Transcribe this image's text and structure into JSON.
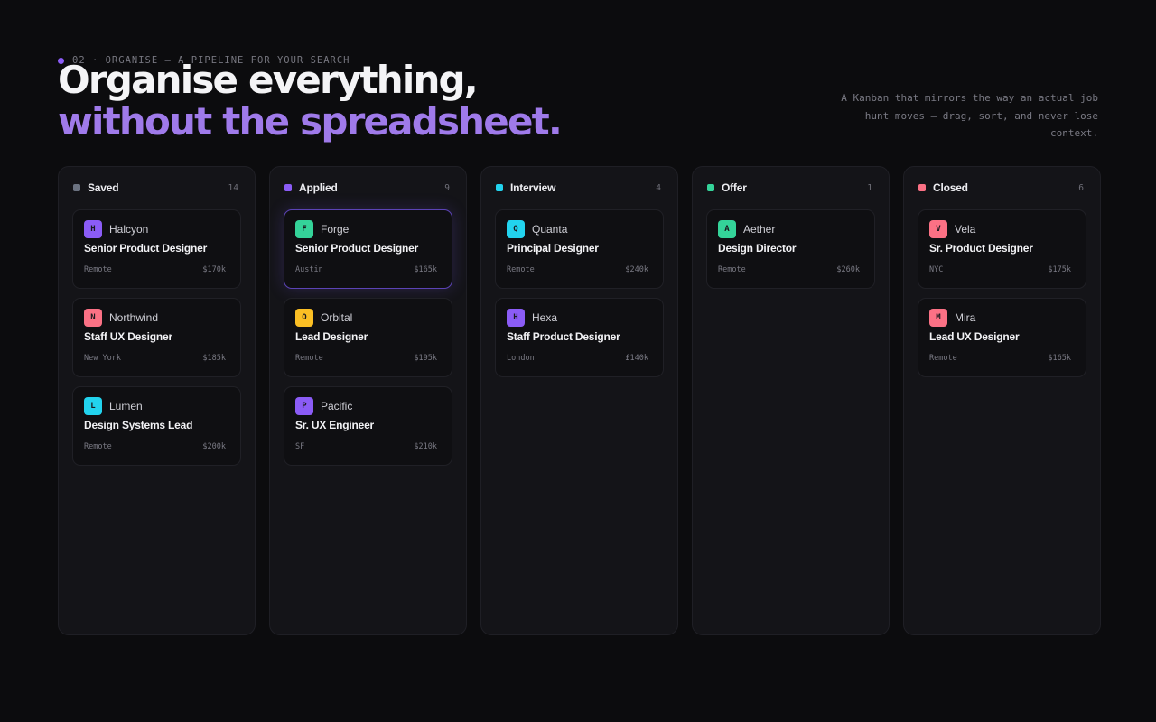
{
  "header": {
    "eyebrow": "02 · ORGANISE — A PIPELINE FOR YOUR SEARCH",
    "title_line1": "Organise everything,",
    "title_line2": "without the spreadsheet.",
    "blurb": "A Kanban that mirrors the way an actual job hunt moves — drag, sort, and never lose context."
  },
  "colors": {
    "accent": "#8b5cf6",
    "saved": "#6b7280",
    "applied": "#8b5cf6",
    "interview": "#22d3ee",
    "offer": "#34d399",
    "closed": "#fb7185"
  },
  "columns": [
    {
      "title": "Saved",
      "count": "14",
      "color": "#6b7280",
      "cards": [
        {
          "initial": "H",
          "company": "Halcyon",
          "role": "Senior Product Designer",
          "location": "Remote",
          "salary": "$170k",
          "logo_color": "#8b5cf6"
        },
        {
          "initial": "N",
          "company": "Northwind",
          "role": "Staff UX Designer",
          "location": "New York",
          "salary": "$185k",
          "logo_color": "#fb7185"
        },
        {
          "initial": "L",
          "company": "Lumen",
          "role": "Design Systems Lead",
          "location": "Remote",
          "salary": "$200k",
          "logo_color": "#22d3ee"
        }
      ]
    },
    {
      "title": "Applied",
      "count": "9",
      "color": "#8b5cf6",
      "cards": [
        {
          "initial": "F",
          "company": "Forge",
          "role": "Senior Product Designer",
          "location": "Austin",
          "salary": "$165k",
          "logo_color": "#34d399",
          "active": true
        },
        {
          "initial": "O",
          "company": "Orbital",
          "role": "Lead Designer",
          "location": "Remote",
          "salary": "$195k",
          "logo_color": "#fbbf24"
        },
        {
          "initial": "P",
          "company": "Pacific",
          "role": "Sr. UX Engineer",
          "location": "SF",
          "salary": "$210k",
          "logo_color": "#8b5cf6"
        }
      ]
    },
    {
      "title": "Interview",
      "count": "4",
      "color": "#22d3ee",
      "cards": [
        {
          "initial": "Q",
          "company": "Quanta",
          "role": "Principal Designer",
          "location": "Remote",
          "salary": "$240k",
          "logo_color": "#22d3ee"
        },
        {
          "initial": "H",
          "company": "Hexa",
          "role": "Staff Product Designer",
          "location": "London",
          "salary": "£140k",
          "logo_color": "#8b5cf6"
        }
      ]
    },
    {
      "title": "Offer",
      "count": "1",
      "color": "#34d399",
      "cards": [
        {
          "initial": "A",
          "company": "Aether",
          "role": "Design Director",
          "location": "Remote",
          "salary": "$260k",
          "logo_color": "#34d399"
        }
      ]
    },
    {
      "title": "Closed",
      "count": "6",
      "color": "#fb7185",
      "cards": [
        {
          "initial": "V",
          "company": "Vela",
          "role": "Sr. Product Designer",
          "location": "NYC",
          "salary": "$175k",
          "logo_color": "#fb7185"
        },
        {
          "initial": "M",
          "company": "Mira",
          "role": "Lead UX Designer",
          "location": "Remote",
          "salary": "$165k",
          "logo_color": "#fb7185"
        }
      ]
    }
  ]
}
